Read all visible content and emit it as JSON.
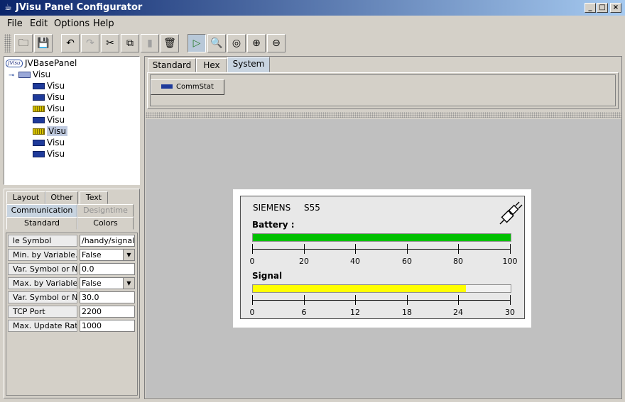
{
  "window": {
    "title": "JVisu Panel Configurator",
    "min": "_",
    "max": "□",
    "close": "×"
  },
  "menu": [
    "File",
    "Edit",
    "Options",
    "Help"
  ],
  "toolbar": [
    "open-icon",
    "save-icon",
    "undo-icon",
    "redo-icon",
    "cut-icon",
    "copy-icon",
    "paste-icon",
    "delete-icon",
    "run-icon",
    "zoom-tool-icon",
    "zoom-fit-icon",
    "zoom-in-icon",
    "zoom-out-icon"
  ],
  "tree": {
    "root": "JVBasePanel",
    "root_badge": "JVisu",
    "child": "Visu",
    "items": [
      {
        "label": "Visu",
        "icon": "label-icon"
      },
      {
        "label": "Visu",
        "icon": "label-icon"
      },
      {
        "label": "Visu",
        "icon": "bargraph-icon"
      },
      {
        "label": "Visu",
        "icon": "label-icon"
      },
      {
        "label": "Visu",
        "icon": "bargraph-icon",
        "selected": true
      },
      {
        "label": "Visu",
        "icon": "label-icon"
      },
      {
        "label": "Visu",
        "icon": "label-icon"
      }
    ]
  },
  "prop_tabs": {
    "row1": [
      "Layout",
      "Other",
      "Text"
    ],
    "row2": [
      "Communication",
      "Designtime"
    ],
    "row3": [
      "Standard",
      "Colors"
    ]
  },
  "properties": [
    {
      "label": "le Symbol",
      "value": "/handy/signal",
      "dropdown": false
    },
    {
      "label": "Min. by Variable.",
      "value": "False",
      "dropdown": true
    },
    {
      "label": "Var. Symbol or Nu",
      "value": "0.0",
      "dropdown": false
    },
    {
      "label": "Max. by Variable.",
      "value": "False",
      "dropdown": true
    },
    {
      "label": "Var. Symbol or Nu",
      "value": "30.0",
      "dropdown": false
    },
    {
      "label": "TCP Port",
      "value": "2200",
      "dropdown": false
    },
    {
      "label": "Max. Update Rate (",
      "value": "1000",
      "dropdown": false
    }
  ],
  "palette_tabs": [
    "Standard",
    "Hex",
    "System"
  ],
  "palette_active": "System",
  "palette_items": [
    {
      "label": "CommStat",
      "badge": "Abcd"
    }
  ],
  "visu_panel": {
    "brand": "SIEMENS",
    "model": "S55",
    "battery_label": "Battery :",
    "battery_value": 100,
    "battery_ticks": [
      "0",
      "20",
      "40",
      "60",
      "80",
      "100"
    ],
    "battery_color": "#00c000",
    "signal_label": "Signal",
    "signal_value": 24.8,
    "signal_ticks": [
      "0",
      "6",
      "12",
      "18",
      "24",
      "30"
    ],
    "signal_color": "#ffff00",
    "signal_max": 30,
    "battery_max": 100,
    "status_icon": "plug-icon"
  }
}
